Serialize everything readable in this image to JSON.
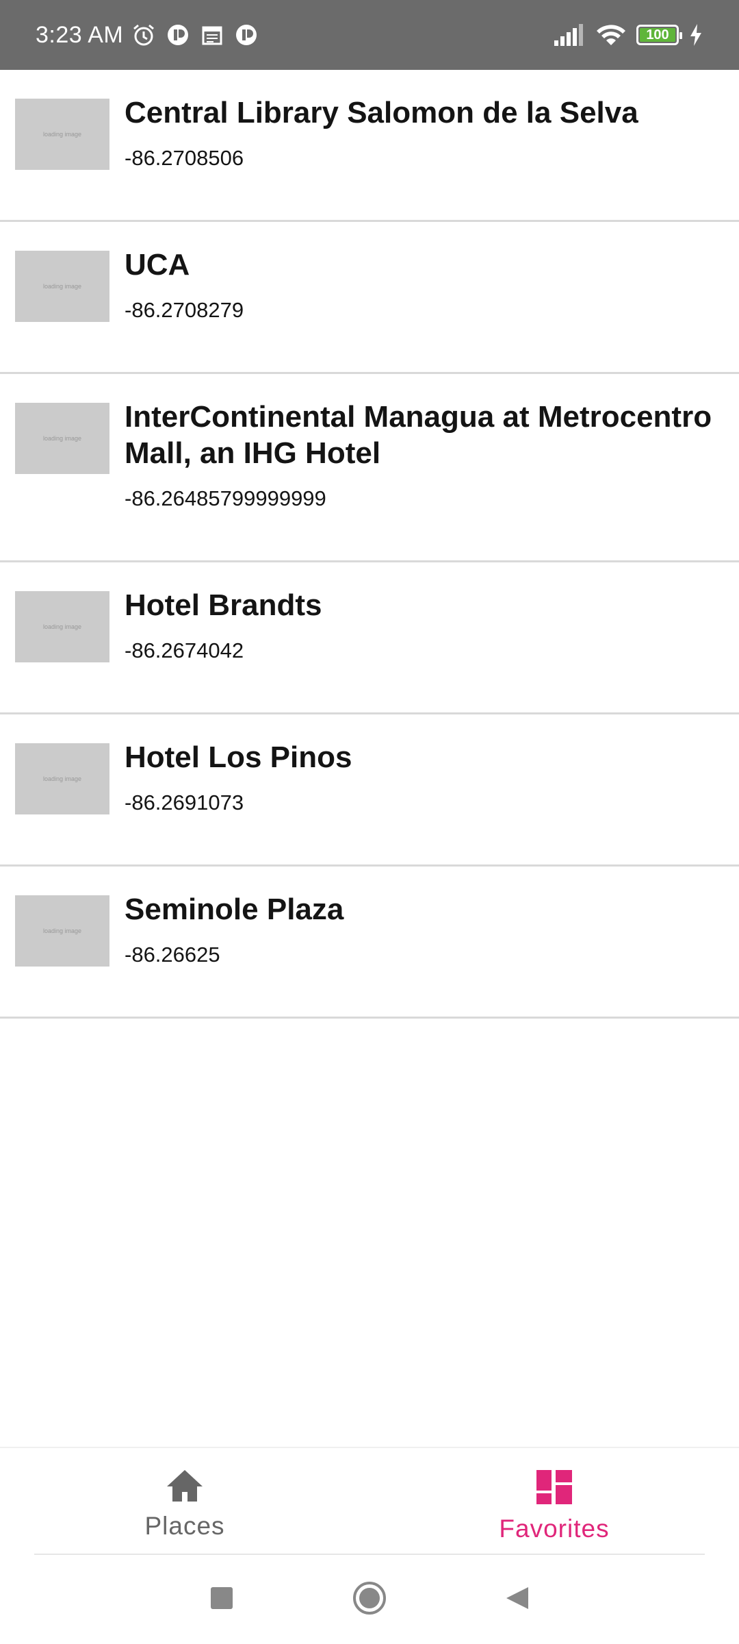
{
  "status_bar": {
    "time": "3:23 AM",
    "left_icons": [
      "alarm-icon",
      "app-notification-icon",
      "calendar-icon",
      "app-notification-icon"
    ],
    "right_icons": [
      "signal-icon",
      "wifi-icon",
      "battery-icon",
      "charging-icon"
    ],
    "battery_level": "100"
  },
  "places": [
    {
      "title": "Central Library Salomon de la Selva",
      "subtitle": "-86.2708506",
      "thumb_text": "loading image"
    },
    {
      "title": "UCA",
      "subtitle": "-86.2708279",
      "thumb_text": "loading image"
    },
    {
      "title": "InterContinental Managua at Metrocentro Mall, an IHG Hotel",
      "subtitle": "-86.26485799999999",
      "thumb_text": "loading image"
    },
    {
      "title": "Hotel Brandts",
      "subtitle": "-86.2674042",
      "thumb_text": "loading image"
    },
    {
      "title": "Hotel Los Pinos",
      "subtitle": "-86.2691073",
      "thumb_text": "loading image"
    },
    {
      "title": "Seminole Plaza",
      "subtitle": "-86.26625",
      "thumb_text": "loading image"
    }
  ],
  "bottom_nav": {
    "places_label": "Places",
    "favorites_label": "Favorites",
    "selected": "Favorites",
    "accent_color": "#e0267a",
    "inactive_color": "#666666"
  },
  "system_nav": [
    "recents-icon",
    "home-icon",
    "back-icon"
  ]
}
